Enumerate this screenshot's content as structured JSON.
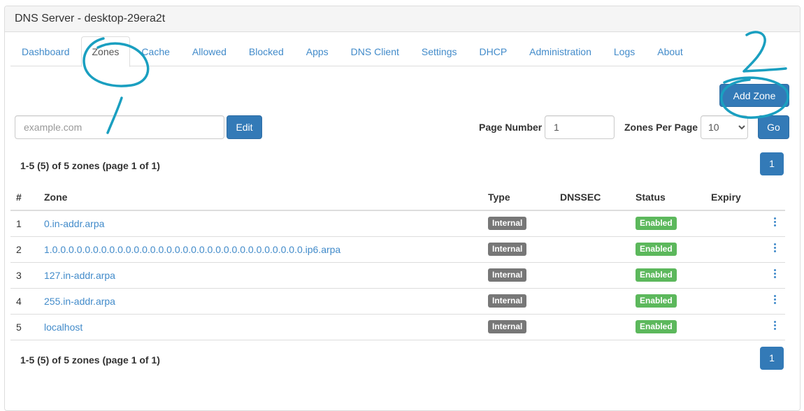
{
  "header": {
    "title": "DNS Server - desktop-29era2t"
  },
  "tabs": [
    {
      "label": "Dashboard"
    },
    {
      "label": "Zones"
    },
    {
      "label": "Cache"
    },
    {
      "label": "Allowed"
    },
    {
      "label": "Blocked"
    },
    {
      "label": "Apps"
    },
    {
      "label": "DNS Client"
    },
    {
      "label": "Settings"
    },
    {
      "label": "DHCP"
    },
    {
      "label": "Administration"
    },
    {
      "label": "Logs"
    },
    {
      "label": "About"
    }
  ],
  "active_tab": "Zones",
  "toolbar": {
    "add_zone_label": "Add Zone",
    "zone_input_placeholder": "example.com",
    "edit_label": "Edit",
    "page_number_label": "Page Number",
    "page_number_value": "1",
    "zones_per_page_label": "Zones Per Page",
    "zones_per_page_value": "10",
    "go_label": "Go"
  },
  "summary_top": "1-5 (5) of 5 zones (page 1 of 1)",
  "summary_bottom": "1-5 (5) of 5 zones (page 1 of 1)",
  "pagination": {
    "current_page": "1"
  },
  "table": {
    "headers": [
      "#",
      "Zone",
      "Type",
      "DNSSEC",
      "Status",
      "Expiry"
    ],
    "rows": [
      {
        "num": "1",
        "zone": "0.in-addr.arpa",
        "type": "Internal",
        "dnssec": "",
        "status": "Enabled",
        "expiry": ""
      },
      {
        "num": "2",
        "zone": "1.0.0.0.0.0.0.0.0.0.0.0.0.0.0.0.0.0.0.0.0.0.0.0.0.0.0.0.0.0.0.0.ip6.arpa",
        "type": "Internal",
        "dnssec": "",
        "status": "Enabled",
        "expiry": ""
      },
      {
        "num": "3",
        "zone": "127.in-addr.arpa",
        "type": "Internal",
        "dnssec": "",
        "status": "Enabled",
        "expiry": ""
      },
      {
        "num": "4",
        "zone": "255.in-addr.arpa",
        "type": "Internal",
        "dnssec": "",
        "status": "Enabled",
        "expiry": ""
      },
      {
        "num": "5",
        "zone": "localhost",
        "type": "Internal",
        "dnssec": "",
        "status": "Enabled",
        "expiry": ""
      }
    ]
  },
  "annotations": {
    "mark_1": "1",
    "mark_2": "2",
    "color": "#1a9fc0"
  },
  "colors": {
    "link": "#428bca",
    "primary_button": "#337ab7",
    "badge_internal": "#777777",
    "badge_enabled": "#5cb85c"
  }
}
